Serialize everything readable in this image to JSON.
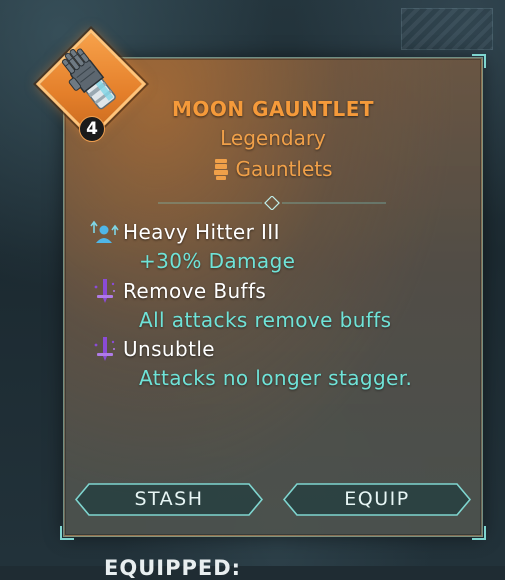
{
  "item": {
    "name": "MOON GAUNTLET",
    "rarity": "Legendary",
    "type": "Gauntlets",
    "count": "4",
    "icon": "gauntlet-icon",
    "type_icon": "fist-icon"
  },
  "perks": [
    {
      "name": "Heavy Hitter III",
      "description": "+30% Damage",
      "icon": "damage-up-icon"
    },
    {
      "name": "Remove Buffs",
      "description": "All attacks remove buffs",
      "icon": "dagger-icon"
    },
    {
      "name": "Unsubtle",
      "description": "Attacks no longer stagger.",
      "icon": "dagger-icon"
    }
  ],
  "actions": {
    "stash_label": "STASH",
    "equip_label": "EQUIP"
  },
  "footer": {
    "equipped_label": "EQUIPPED:"
  },
  "colors": {
    "legendary": "#f59a3a",
    "accent": "#6fe3d8",
    "perk_icon_purple": "#8a4bd6",
    "perk_icon_blue": "#4fb6e8"
  }
}
